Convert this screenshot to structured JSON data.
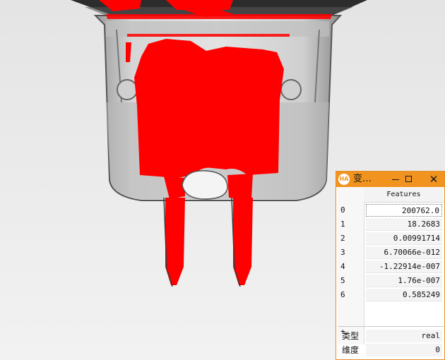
{
  "window": {
    "app_icon_text": "HA",
    "title": "变…",
    "close_glyph": "✕",
    "column_header": "Features"
  },
  "rows": [
    {
      "index": "0",
      "value": "200762.0"
    },
    {
      "index": "1",
      "value": "18.2683"
    },
    {
      "index": "2",
      "value": "0.00991714"
    },
    {
      "index": "3",
      "value": "6.70066e-012"
    },
    {
      "index": "4",
      "value": "-1.22914e-007"
    },
    {
      "index": "5",
      "value": "1.76e-007"
    },
    {
      "index": "6",
      "value": "0.585249"
    }
  ],
  "add_row_symbol": "+",
  "properties": {
    "type_label": "类型",
    "type_value": "real",
    "dim_label": "维度",
    "dim_value": "0"
  },
  "colors": {
    "region_overlay": "#ff0000",
    "titlebar": "#f0931f",
    "background": "#ececec"
  },
  "icons": [
    "app-logo-icon",
    "minimize-icon",
    "maximize-icon",
    "close-icon"
  ]
}
